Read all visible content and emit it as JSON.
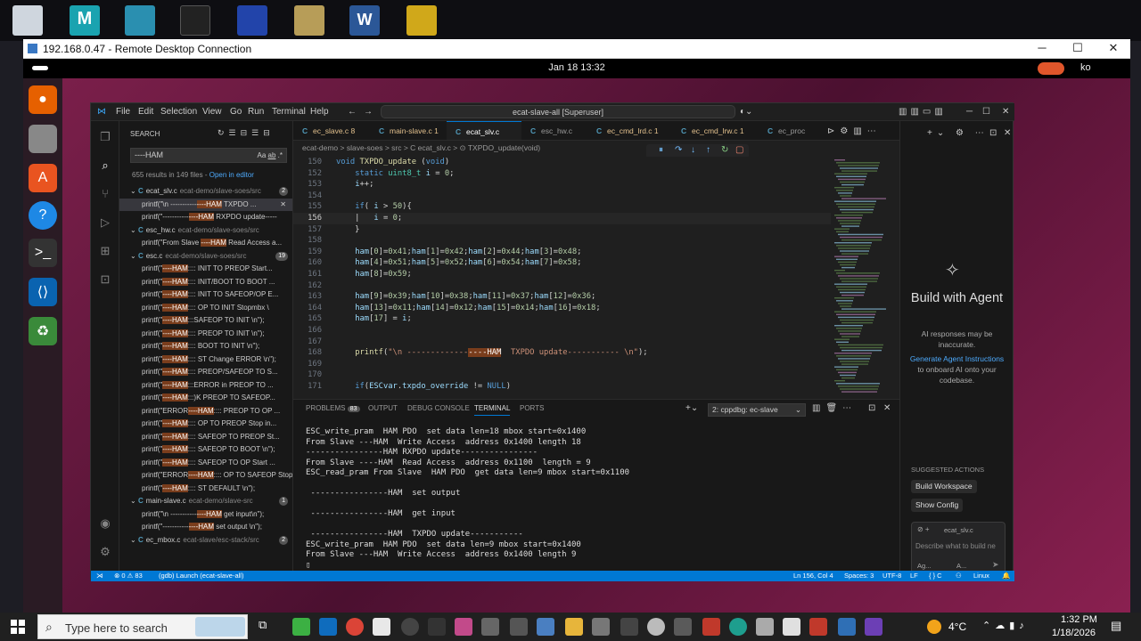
{
  "rdp": {
    "title": "192.168.0.47 - Remote Desktop Connection"
  },
  "ubuntu": {
    "clock": "Jan 18  13:32",
    "user": "ko"
  },
  "vscode": {
    "menu": [
      "File",
      "Edit",
      "Selection",
      "View",
      "Go",
      "Run",
      "Terminal",
      "Help"
    ],
    "command_center": "ecat-slave-all [Superuser]",
    "search": {
      "header": "SEARCH",
      "query": "----HAM",
      "summary": "655 results in 149 files",
      "open_in_editor": "Open in editor",
      "tree": [
        {
          "kind": "file",
          "name": "ecat_slv.c",
          "path": "ecat-demo/slave-soes/src",
          "count": "2"
        },
        {
          "kind": "match",
          "pre": "printf(\"\\n -----------",
          "hl": "----HAM",
          "post": " TXPDO ...",
          "selected": true
        },
        {
          "kind": "match",
          "pre": "printf(\"-----------",
          "hl": "----HAM",
          "post": " RXPDO update-----"
        },
        {
          "kind": "file",
          "name": "esc_hw.c",
          "path": "ecat-demo/slave-soes/src",
          "count": ""
        },
        {
          "kind": "match",
          "pre": "printf(\"From Slave ",
          "hl": "----HAM",
          "post": " Read Access  a..."
        },
        {
          "kind": "file",
          "name": "esc.c",
          "path": "ecat-demo/slave-soes/src",
          "count": "19"
        },
        {
          "kind": "match",
          "pre": "printf(\"",
          "hl": "----HAM",
          "post": ":::: INIT TO PREOP  Start..."
        },
        {
          "kind": "match",
          "pre": "printf(\"",
          "hl": "----HAM",
          "post": ":::: INIT/BOOT TO BOOT ..."
        },
        {
          "kind": "match",
          "pre": "printf(\"",
          "hl": "----HAM",
          "post": ":::: INIT TO SAFEOP/OP  E..."
        },
        {
          "kind": "match",
          "pre": "printf(\"",
          "hl": "----HAM",
          "post": ":::: OP TO INIT  Stopmbx \\"
        },
        {
          "kind": "match",
          "pre": "printf(\"",
          "hl": "----HAM",
          "post": ":::SAFEOP TO INIT \\n\");"
        },
        {
          "kind": "match",
          "pre": "printf(\"",
          "hl": "----HAM",
          "post": ":::: PREOP TO INIT  \\n\");"
        },
        {
          "kind": "match",
          "pre": "printf(\"",
          "hl": "----HAM",
          "post": ":::: BOOT TO INIT  \\n\");"
        },
        {
          "kind": "match",
          "pre": "printf(\"",
          "hl": "----HAM",
          "post": ":::: ST Change ERROR  \\n\");"
        },
        {
          "kind": "match",
          "pre": "printf(\"",
          "hl": "----HAM",
          "post": ":::: PREOP/SAFEOP TO S..."
        },
        {
          "kind": "match",
          "pre": "printf(\"",
          "hl": "----HAM",
          "post": ":::ERROR  in   PREOP TO ..."
        },
        {
          "kind": "match",
          "pre": "printf(\"",
          "hl": "----HAM",
          "post": ":::)K  PREOP TO SAFEOP..."
        },
        {
          "kind": "match",
          "pre": "printf(\"ERROR",
          "hl": "----HAM",
          "post": ":::: PREOP TO OP ..."
        },
        {
          "kind": "match",
          "pre": "printf(\"",
          "hl": "----HAM",
          "post": ":::: OP TO PREOP Stop in..."
        },
        {
          "kind": "match",
          "pre": "printf(\"",
          "hl": "----HAM",
          "post": ":::: SAFEOP TO PREOP  St..."
        },
        {
          "kind": "match",
          "pre": "printf(\"",
          "hl": "----HAM",
          "post": ":::: SAFEOP TO BOOT \\n\");"
        },
        {
          "kind": "match",
          "pre": "printf(\"",
          "hl": "----HAM",
          "post": ":::: SAFEOP TO OP Start ..."
        },
        {
          "kind": "match",
          "pre": "printf(\"ERROR",
          "hl": "----HAM",
          "post": ":::: OP TO SAFEOP  Stop ..."
        },
        {
          "kind": "match",
          "pre": "printf(\"",
          "hl": "----HAM",
          "post": ":::: ST DEFAULT  \\n\");"
        },
        {
          "kind": "file",
          "name": "main-slave.c",
          "path": "ecat-demo/slave-src",
          "count": "1"
        },
        {
          "kind": "match",
          "pre": "printf(\"\\n -----------",
          "hl": "----HAM",
          "post": " get input\\n\");"
        },
        {
          "kind": "match",
          "pre": "printf(\"-----------",
          "hl": "----HAM",
          "post": " set output \\n\");"
        },
        {
          "kind": "file",
          "name": "ec_mbox.c",
          "path": "ecat-slave/esc-stack/src",
          "count": "2"
        }
      ]
    },
    "tabs": [
      {
        "label": "ec_slave.c 8",
        "modified": true
      },
      {
        "label": "main-slave.c 1",
        "modified": true
      },
      {
        "label": "ecat_slv.c",
        "active": true
      },
      {
        "label": "esc_hw.c"
      },
      {
        "label": "ec_cmd_lrd.c 1",
        "modified": true
      },
      {
        "label": "ec_cmd_lrw.c 1",
        "modified": true
      },
      {
        "label": "ec_proc"
      }
    ],
    "breadcrumbs": "ecat-demo  >  slave-soes  >  src  >  C  ecat_slv.c  >  ⊙ TXPDO_update(void)",
    "code_lines": [
      {
        "n": "150",
        "html": "<span class='kw'>void</span> <span class='fn'>TXPDO_update</span> <span class='pu'>(</span><span class='kw'>void</span><span class='pu'>)</span>"
      },
      {
        "n": "152",
        "html": "    <span class='kw'>static</span> <span class='ty'>uint8_t</span> <span class='va'>i</span> = <span class='nu'>0</span>;"
      },
      {
        "n": "153",
        "html": "    <span class='va'>i</span>++;"
      },
      {
        "n": "154",
        "html": ""
      },
      {
        "n": "155",
        "html": "    <span class='kw'>if</span>( <span class='va'>i</span> &gt; <span class='nu'>50</span>){"
      },
      {
        "n": "156",
        "html": "    |   <span class='va'>i</span> = <span class='nu'>0</span>;",
        "cur": true
      },
      {
        "n": "157",
        "html": "    }"
      },
      {
        "n": "158",
        "html": ""
      },
      {
        "n": "159",
        "html": "    <span class='va'>ham</span>[<span class='nu'>0</span>]=<span class='nu'>0x41</span>;<span class='va'>ham</span>[<span class='nu'>1</span>]=<span class='nu'>0x42</span>;<span class='va'>ham</span>[<span class='nu'>2</span>]=<span class='nu'>0x44</span>;<span class='va'>ham</span>[<span class='nu'>3</span>]=<span class='nu'>0x48</span>;"
      },
      {
        "n": "160",
        "html": "    <span class='va'>ham</span>[<span class='nu'>4</span>]=<span class='nu'>0x51</span>;<span class='va'>ham</span>[<span class='nu'>5</span>]=<span class='nu'>0x52</span>;<span class='va'>ham</span>[<span class='nu'>6</span>]=<span class='nu'>0x54</span>;<span class='va'>ham</span>[<span class='nu'>7</span>]=<span class='nu'>0x58</span>;"
      },
      {
        "n": "161",
        "html": "    <span class='va'>ham</span>[<span class='nu'>8</span>]=<span class='nu'>0x59</span>;"
      },
      {
        "n": "162",
        "html": ""
      },
      {
        "n": "163",
        "html": "    <span class='va'>ham</span>[<span class='nu'>9</span>]=<span class='nu'>0x39</span>;<span class='va'>ham</span>[<span class='nu'>10</span>]=<span class='nu'>0x38</span>;<span class='va'>ham</span>[<span class='nu'>11</span>]=<span class='nu'>0x37</span>;<span class='va'>ham</span>[<span class='nu'>12</span>]=<span class='nu'>0x36</span>;"
      },
      {
        "n": "164",
        "html": "    <span class='va'>ham</span>[<span class='nu'>13</span>]=<span class='nu'>0x11</span>;<span class='va'>ham</span>[<span class='nu'>14</span>]=<span class='nu'>0x12</span>;<span class='va'>ham</span>[<span class='nu'>15</span>]=<span class='nu'>0x14</span>;<span class='va'>ham</span>[<span class='nu'>16</span>]=<span class='nu'>0x18</span>;"
      },
      {
        "n": "165",
        "html": "    <span class='va'>ham</span>[<span class='nu'>17</span>] = <span class='va'>i</span>;"
      },
      {
        "n": "166",
        "html": ""
      },
      {
        "n": "167",
        "html": ""
      },
      {
        "n": "168",
        "html": "    <span class='fn'>printf</span>(<span class='st'>\"\\n -------------<span class='hl'>----HAM</span>  TXPDO update----------- \\n\"</span>);"
      },
      {
        "n": "169",
        "html": ""
      },
      {
        "n": "170",
        "html": ""
      },
      {
        "n": "171",
        "html": "    <span class='kw'>if</span>(<span class='va'>ESCvar</span>.<span class='va'>txpdo_override</span> != <span class='kw'>NULL</span>)"
      }
    ],
    "panel": {
      "tabs": [
        "PROBLEMS",
        "OUTPUT",
        "DEBUG CONSOLE",
        "TERMINAL",
        "PORTS"
      ],
      "problems_count": "83",
      "terminal_select": "2: cppdbg: ec-slave",
      "terminal_lines": [
        "ESC_write_pram  HAM PDO  set data len=18 mbox start=0x1400",
        "From Slave ---HAM  Write Access  address 0x1400 length 18",
        "----------------HAM RXPDO update----------------",
        "From Slave ----HAM  Read Access  address 0x1100  length = 9",
        "ESC_read_pram From Slave  HAM PDO  get data len=9 mbox start=0x1100",
        "",
        " ----------------HAM  set output",
        "",
        " ----------------HAM  get input",
        "",
        " ----------------HAM  TXPDO update-----------",
        "ESC_write_pram  HAM PDO  set data len=9 mbox start=0x1400",
        "From Slave ---HAM  Write Access  address 0x1400 length 9",
        "▯"
      ]
    },
    "chat": {
      "title": "Build with Agent",
      "disclaimer": "AI responses may be inaccurate.",
      "link": "Generate Agent Instructions",
      "link_suffix": "to onboard AI onto your codebase.",
      "suggested": "SUGGESTED ACTIONS",
      "btn1": "Build Workspace",
      "btn2": "Show Config",
      "context": "ecat_slv.c",
      "placeholder": "Describe what to build ne",
      "mode": "Ag...",
      "model": "A..."
    },
    "status": {
      "errors": "⊗ 0  ⚠ 83",
      "launch": "(gdb) Launch (ecat-slave-all)",
      "position": "Ln 156, Col 4",
      "spaces": "Spaces: 3",
      "encoding": "UTF-8",
      "eol": "LF",
      "lang": "{ } C",
      "os": "Linux"
    }
  },
  "taskbar": {
    "search_placeholder": "Type here to search",
    "weather": "4°C",
    "time": "1:32 PM",
    "date": "1/18/2026"
  }
}
